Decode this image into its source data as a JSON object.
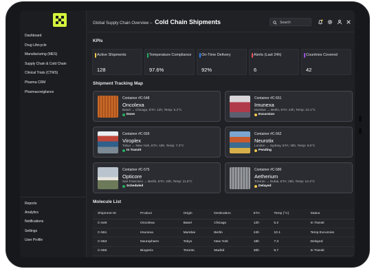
{
  "breadcrumb": {
    "prefix": "Global Supply Chain Overview",
    "separator": "–",
    "title": "Cold Chain Shipments"
  },
  "search": {
    "placeholder": "Search"
  },
  "sidebar": {
    "items": [
      {
        "label": "Dashboard"
      },
      {
        "label": "Drug Lifecycle"
      },
      {
        "label": "Manufacturing (MES)"
      },
      {
        "label": "Supply Chain & Cold Chain"
      },
      {
        "label": "Clinical Trials (CTMS)"
      },
      {
        "label": "Pharma CRM"
      },
      {
        "label": "Pharmacovigilance"
      }
    ],
    "bottom_items": [
      {
        "label": "Reports"
      },
      {
        "label": "Analytics"
      },
      {
        "label": "Notifications"
      },
      {
        "label": "Settings"
      },
      {
        "label": "User Profile"
      }
    ]
  },
  "kpis": {
    "title": "KPIs",
    "items": [
      {
        "label": "Active Shipments",
        "value": "128",
        "color": "#f2c94c"
      },
      {
        "label": "Temperature Compliance",
        "value": "97.6%",
        "color": "#27ae60"
      },
      {
        "label": "On-Time Delivery",
        "value": "92%",
        "color": "#2f80ed"
      },
      {
        "label": "Alerts (Last 24h)",
        "value": "6",
        "color": "#eb5757"
      },
      {
        "label": "Countries Covered",
        "value": "42",
        "color": "#9b51e0"
      }
    ]
  },
  "map": {
    "title": "Shipment Tracking Map",
    "cards": [
      {
        "id": "Container #C-548",
        "name": "Oncolexa",
        "route": "Basel → Chicago, ETA: 12h, Temp: 5.2°C",
        "status": "Done",
        "status_color": "#27ae60"
      },
      {
        "id": "Container #C-551",
        "name": "Imunexa",
        "route": "Mumbai → Berlin, ETA: 24h, Temp: 10.1°C",
        "status": "Excursion",
        "status_color": "#f2c94c"
      },
      {
        "id": "Container #C-559",
        "name": "Viroplex",
        "route": "Tokyo → New York, ETA: 18h, Temp: 7.3°C",
        "status": "In Transit",
        "status_color": "#27ae60"
      },
      {
        "id": "Container #C-562",
        "name": "Neurotix",
        "route": "London → Sydney, ETA: 30h, Temp: 9.5°C",
        "status": "Pending",
        "status_color": "#f2c94c"
      },
      {
        "id": "Container #C-575",
        "name": "Opticore",
        "route": "San Francisco → Berlin, ETA: 22h, Temp: 11.5°C",
        "status": "Scheduled",
        "status_color": "#27ae60"
      },
      {
        "id": "Container #C-580",
        "name": "Aetherium",
        "route": "Toronto → Dubai, ETA: 26h, Temp: 12.4°C",
        "status": "Delayed",
        "status_color": "#f2c94c"
      }
    ]
  },
  "molecules": {
    "title": "Molecule List",
    "columns": [
      "Shipment ID",
      "Product",
      "Origin",
      "Destination",
      "ETA",
      "Temp (°C)",
      "Status"
    ],
    "rows": [
      [
        "C-548",
        "Oncolexa",
        "Basel",
        "Chicago",
        "12h",
        "5.2",
        "In Transit"
      ],
      [
        "C-551",
        "Imunexa",
        "Mumbai",
        "Berlin",
        "24h",
        "10.1",
        "Temp Excursion"
      ],
      [
        "C-553",
        "Neuropharm",
        "Tokyo",
        "New York",
        "18h",
        "7.3",
        "Delayed"
      ],
      [
        "C-556",
        "Biogenix",
        "Toronto",
        "Madrid",
        "36h",
        "6.7",
        "In Transit"
      ]
    ]
  }
}
